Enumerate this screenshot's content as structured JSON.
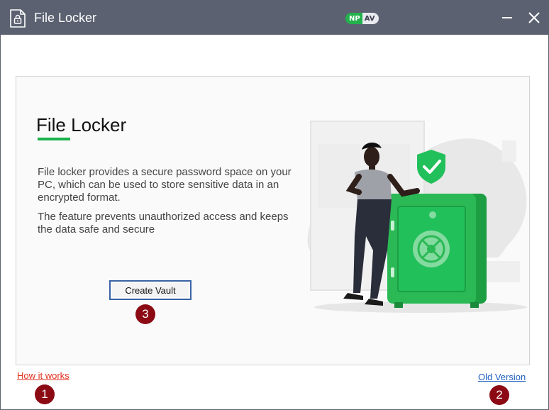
{
  "window": {
    "title": "File Locker",
    "brand": {
      "left": "NP",
      "right": "AV"
    },
    "controls": {
      "minimize_icon": "minimize-icon",
      "close_icon": "close-icon"
    }
  },
  "main": {
    "heading": "File Locker",
    "description_1": "File locker provides a secure password space on your PC, which can be used to store sensitive data in an encrypted format.",
    "description_2": "The feature prevents unauthorized access and keeps the data safe and secure",
    "create_button_label": "Create Vault",
    "illustration_icon": "person-with-safe-illustration"
  },
  "footer": {
    "how_it_works": "How it works",
    "old_version": "Old Version"
  },
  "badges": {
    "one": "1",
    "two": "2",
    "three": "3"
  },
  "colors": {
    "titlebar": "#5b6170",
    "accent_green": "#1bb14c",
    "badge": "#8b0a14",
    "link_red": "#e0301e",
    "link_blue": "#1f5fbf"
  }
}
